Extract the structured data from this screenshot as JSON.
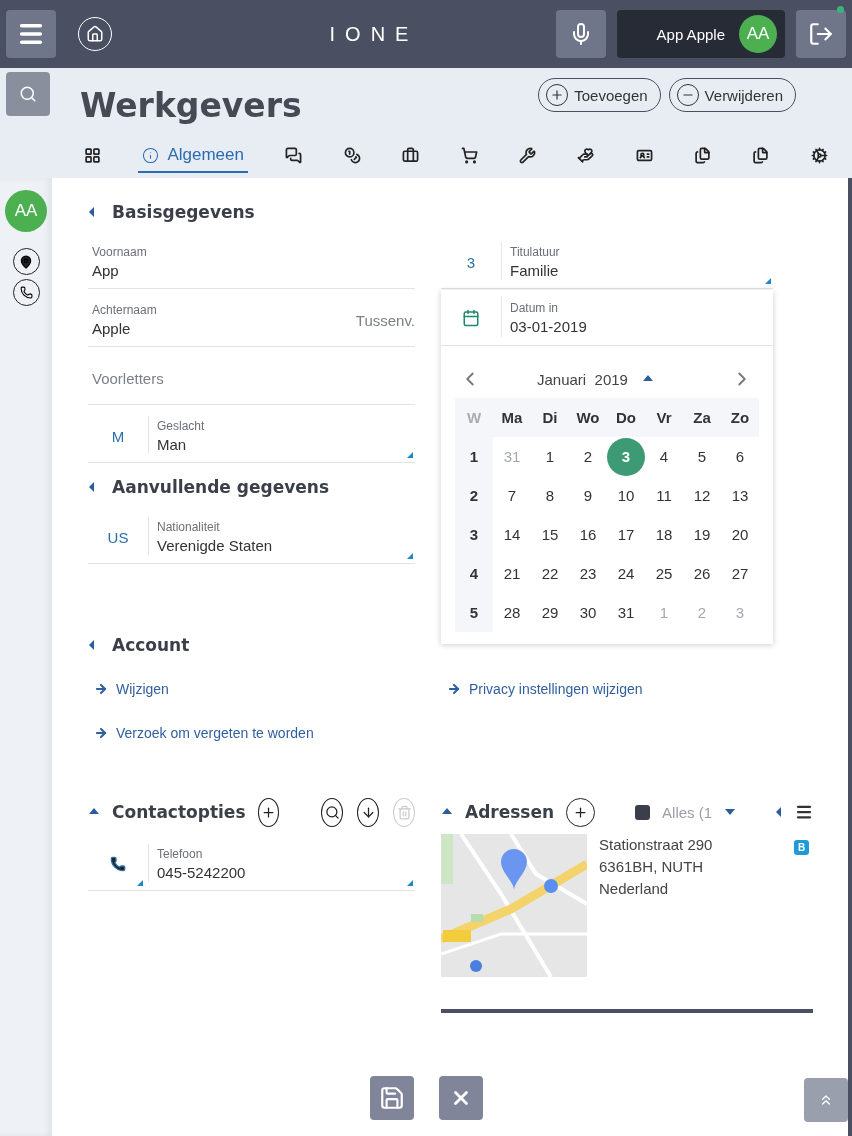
{
  "topbar": {
    "brand": "IONE",
    "user_name": "App Apple",
    "user_initials": "AA"
  },
  "page": {
    "title": "Werkgevers",
    "actions": [
      {
        "kind": "add",
        "label": "Toevoegen"
      },
      {
        "kind": "remove",
        "label": "Verwijderen"
      }
    ]
  },
  "tabs": [
    {
      "selected": false
    },
    {
      "label": "Algemeen",
      "selected": true
    },
    {
      "selected": false
    },
    {
      "selected": false
    },
    {
      "selected": false
    },
    {
      "selected": false
    },
    {
      "selected": false
    },
    {
      "selected": false
    },
    {
      "selected": false
    },
    {
      "selected": false
    },
    {
      "selected": false
    },
    {
      "selected": false
    }
  ],
  "sidebar": {
    "initials": "AA"
  },
  "basisgegevens": {
    "title": "Basisgegevens",
    "fields": [
      {
        "label": "Voornaam",
        "value": "App"
      },
      {
        "label": "Achternaam",
        "value": "Apple",
        "second": {
          "placeholder": "Tussenv."
        }
      },
      {
        "placeholder": "Voorletters"
      },
      {
        "prefix": "M",
        "label": "Geslacht",
        "value": "Man",
        "dropdown": true
      }
    ]
  },
  "aanvullende_gegevens": {
    "title": "Aanvullende gegevens",
    "fields": [
      {
        "prefix": "US",
        "label": "Nationaliteit",
        "value": "Verenigde Staten",
        "dropdown": true
      }
    ]
  },
  "titulatuur": {
    "prefix": "3",
    "label": "Titulatuur",
    "value": "Familie",
    "dropdown": true
  },
  "date_field": {
    "label": "Datum in",
    "value": "03-01-2019"
  },
  "calendar": {
    "month": "Januari",
    "year": "2019",
    "week_header": "W",
    "weekdays": [
      "Ma",
      "Di",
      "Wo",
      "Do",
      "Vr",
      "Za",
      "Zo"
    ],
    "weeks": [
      {
        "number": "1",
        "days": [
          {
            "label": "31",
            "muted": true,
            "selected": false
          },
          {
            "label": "1",
            "muted": false,
            "selected": false
          },
          {
            "label": "2",
            "muted": false,
            "selected": false
          },
          {
            "label": "3",
            "muted": false,
            "selected": true
          },
          {
            "label": "4",
            "muted": false,
            "selected": false
          },
          {
            "label": "5",
            "muted": false,
            "selected": false
          },
          {
            "label": "6",
            "muted": false,
            "selected": false
          }
        ]
      },
      {
        "number": "2",
        "days": [
          {
            "label": "7",
            "muted": false,
            "selected": false
          },
          {
            "label": "8",
            "muted": false,
            "selected": false
          },
          {
            "label": "9",
            "muted": false,
            "selected": false
          },
          {
            "label": "10",
            "muted": false,
            "selected": false
          },
          {
            "label": "11",
            "muted": false,
            "selected": false
          },
          {
            "label": "12",
            "muted": false,
            "selected": false
          },
          {
            "label": "13",
            "muted": false,
            "selected": false
          }
        ]
      },
      {
        "number": "3",
        "days": [
          {
            "label": "14",
            "muted": false,
            "selected": false
          },
          {
            "label": "15",
            "muted": false,
            "selected": false
          },
          {
            "label": "16",
            "muted": false,
            "selected": false
          },
          {
            "label": "17",
            "muted": false,
            "selected": false
          },
          {
            "label": "18",
            "muted": false,
            "selected": false
          },
          {
            "label": "19",
            "muted": false,
            "selected": false
          },
          {
            "label": "20",
            "muted": false,
            "selected": false
          }
        ]
      },
      {
        "number": "4",
        "days": [
          {
            "label": "21",
            "muted": false,
            "selected": false
          },
          {
            "label": "22",
            "muted": false,
            "selected": false
          },
          {
            "label": "23",
            "muted": false,
            "selected": false
          },
          {
            "label": "24",
            "muted": false,
            "selected": false
          },
          {
            "label": "25",
            "muted": false,
            "selected": false
          },
          {
            "label": "26",
            "muted": false,
            "selected": false
          },
          {
            "label": "27",
            "muted": false,
            "selected": false
          }
        ]
      },
      {
        "number": "5",
        "days": [
          {
            "label": "28",
            "muted": false,
            "selected": false
          },
          {
            "label": "29",
            "muted": false,
            "selected": false
          },
          {
            "label": "30",
            "muted": false,
            "selected": false
          },
          {
            "label": "31",
            "muted": false,
            "selected": false
          },
          {
            "label": "1",
            "muted": true,
            "selected": false
          },
          {
            "label": "2",
            "muted": true,
            "selected": false
          },
          {
            "label": "3",
            "muted": true,
            "selected": false
          }
        ]
      }
    ]
  },
  "account": {
    "title": "Account",
    "links": [
      "Wijzigen",
      "Verzoek om vergeten te worden"
    ]
  },
  "privacy": {
    "links": [
      "Privacy instellingen wijzigen"
    ]
  },
  "contactopties": {
    "title": "Contactopties",
    "tools": [
      {
        "kind": "add",
        "disabled": false
      },
      {
        "kind": "search",
        "disabled": false
      },
      {
        "kind": "download",
        "disabled": false
      },
      {
        "kind": "delete",
        "disabled": true
      }
    ],
    "fields": [
      {
        "label": "Telefoon",
        "value": "045-5242200",
        "dropdown": true
      }
    ]
  },
  "adressen": {
    "title": "Adressen",
    "filter": {
      "label": "Alles (1",
      "checked": true
    },
    "address": {
      "lines": [
        "Stationstraat 290",
        "6361BH, NUTH",
        "Nederland"
      ],
      "badge": "B"
    }
  }
}
